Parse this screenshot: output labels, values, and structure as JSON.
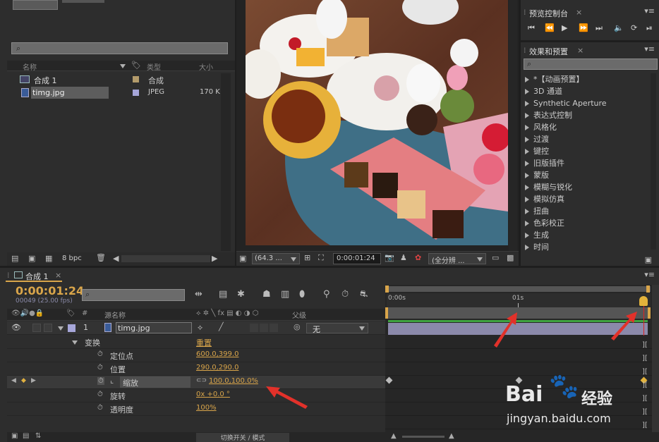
{
  "project": {
    "search_icon": "magnifier-icon",
    "columns": {
      "name": "名称",
      "type": "类型",
      "size": "大小"
    },
    "items": [
      {
        "name": "合成  1",
        "type": "合成",
        "size": "",
        "color": "#b39b6b"
      },
      {
        "name": "timg.jpg",
        "type": "JPEG",
        "size": "170 K",
        "color": "#a6a6d9"
      }
    ],
    "bpc": "8 bpc"
  },
  "viewer": {
    "zoom": "(64.3 ...",
    "timecode": "0:00:01:24",
    "resolution": "(全分辨 ..."
  },
  "preview": {
    "title": "预览控制台"
  },
  "effects": {
    "title": "效果和预置",
    "items": [
      "*【动画预置】",
      "3D 通道",
      "Synthetic Aperture",
      "表达式控制",
      "风格化",
      "过渡",
      "键控",
      "旧版插件",
      "蒙版",
      "模糊与锐化",
      "模拟仿真",
      "扭曲",
      "色彩校正",
      "生成",
      "时间"
    ]
  },
  "timeline": {
    "tab": "合成  1",
    "timecode": "0:00:01:24",
    "frame_info": "00049 (25.00 fps)",
    "col_source": "源名称",
    "col_parent": "父级",
    "layer_num": "1",
    "layer_name": "timg.jpg",
    "parent_value": "无",
    "transform": "变换",
    "reset": "重置",
    "props": [
      {
        "name": "定位点",
        "value": "600.0,399.0"
      },
      {
        "name": "位置",
        "value": "290.0,290.0"
      },
      {
        "name": "缩放",
        "value": "100.0,100.0%"
      },
      {
        "name": "旋转",
        "value": "0x +0.0 °"
      },
      {
        "name": "透明度",
        "value": "100%"
      }
    ],
    "toggle_label": "切换开关 / 模式",
    "ruler": {
      "start": "0:00s",
      "mid": "01s"
    }
  },
  "watermark": {
    "brand": "Bai",
    "brand2": "经验",
    "url": "jingyan.baidu.com"
  }
}
